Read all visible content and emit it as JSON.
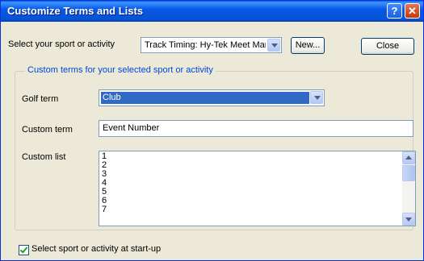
{
  "window": {
    "title": "Customize Terms and Lists",
    "help_label": "?",
    "close_label": "✕"
  },
  "sport": {
    "label": "Select your sport or activity",
    "selected": "Track Timing: Hy-Tek Meet Mana",
    "new_label": "New...",
    "close_button_label": "Close"
  },
  "custom_group": {
    "legend": "Custom terms for your selected sport or activity",
    "golf_term_label": "Golf term",
    "golf_term_value": "Club",
    "custom_term_label": "Custom term",
    "custom_term_value": "Event Number",
    "custom_list_label": "Custom list",
    "custom_list_items": [
      "1",
      "2",
      "3",
      "4",
      "5",
      "6",
      "7"
    ]
  },
  "startup": {
    "label": "Select sport or activity at start-up",
    "checked": true
  },
  "colors": {
    "titlebar": "#0553d6",
    "dialog_bg": "#ece9d8",
    "selection": "#316ac5",
    "legend_text": "#0046d5"
  }
}
